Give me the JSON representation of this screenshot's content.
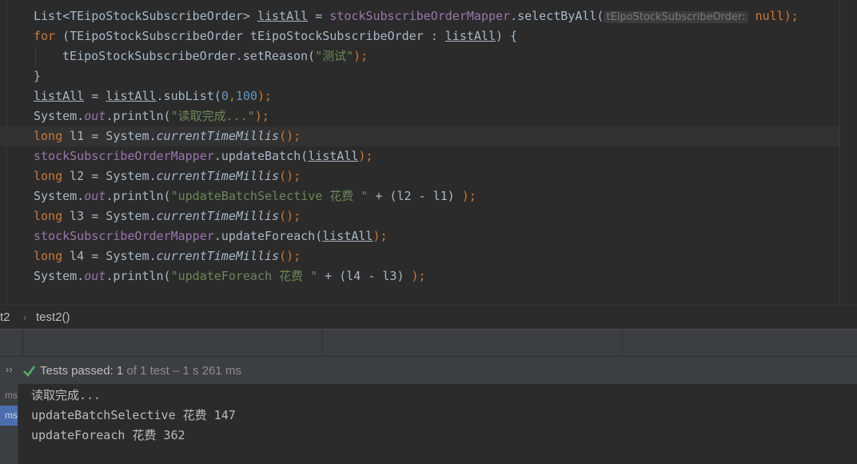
{
  "editor": {
    "lines": [
      {
        "seg": [
          {
            "t": "List<TEipoStockSubscribeOrder> "
          },
          {
            "t": "listAll",
            "c": "ul"
          },
          {
            "t": " = "
          },
          {
            "t": "stockSubscribeOrderMapper",
            "c": "fld"
          },
          {
            "t": ".selectByAll("
          },
          {
            "t": "tEipoStockSubscribeOrder:",
            "c": "hint"
          },
          {
            "t": " "
          },
          {
            "t": "null",
            "c": "kw"
          },
          {
            "t": ");",
            "c": "kw"
          }
        ]
      },
      {
        "seg": [
          {
            "t": "for",
            "c": "kw"
          },
          {
            "t": " (TEipoStockSubscribeOrder tEipoStockSubscribeOrder : "
          },
          {
            "t": "listAll",
            "c": "ul"
          },
          {
            "t": ") {"
          }
        ]
      },
      {
        "indent": true,
        "seg": [
          {
            "t": "tEipoStockSubscribeOrder.setReason("
          },
          {
            "t": "\"测试\"",
            "c": "str"
          },
          {
            "t": ");",
            "c": "kw"
          }
        ]
      },
      {
        "seg": [
          {
            "t": "}"
          }
        ]
      },
      {
        "seg": [
          {
            "t": "listAll",
            "c": "ul"
          },
          {
            "t": " = "
          },
          {
            "t": "listAll",
            "c": "ul"
          },
          {
            "t": ".subList("
          },
          {
            "t": "0",
            "c": "num"
          },
          {
            "t": ",",
            "c": "kw"
          },
          {
            "t": "100",
            "c": "num"
          },
          {
            "t": ");",
            "c": "kw"
          }
        ]
      },
      {
        "seg": [
          {
            "t": "System."
          },
          {
            "t": "out",
            "c": "fld it"
          },
          {
            "t": ".println("
          },
          {
            "t": "\"读取完成...\"",
            "c": "str"
          },
          {
            "t": ");",
            "c": "kw"
          }
        ]
      },
      {
        "current": true,
        "seg": [
          {
            "t": "long",
            "c": "kw"
          },
          {
            "t": " l1 = System."
          },
          {
            "t": "currentTimeMillis",
            "c": "it"
          },
          {
            "t": "();",
            "c": "kw"
          }
        ]
      },
      {
        "seg": [
          {
            "t": "stockSubscribeOrderMapper",
            "c": "fld"
          },
          {
            "t": ".updateBatch("
          },
          {
            "t": "listAll",
            "c": "ul"
          },
          {
            "t": ");",
            "c": "kw"
          }
        ]
      },
      {
        "seg": [
          {
            "t": "long",
            "c": "kw"
          },
          {
            "t": " l2 = System."
          },
          {
            "t": "currentTimeMillis",
            "c": "it"
          },
          {
            "t": "();",
            "c": "kw"
          }
        ]
      },
      {
        "seg": [
          {
            "t": "System."
          },
          {
            "t": "out",
            "c": "fld it"
          },
          {
            "t": ".println("
          },
          {
            "t": "\"updateBatchSelective 花费 \"",
            "c": "str"
          },
          {
            "t": " + (l2 - l1) "
          },
          {
            "t": ");",
            "c": "kw"
          }
        ]
      },
      {
        "seg": [
          {
            "t": "long",
            "c": "kw"
          },
          {
            "t": " l3 = System."
          },
          {
            "t": "currentTimeMillis",
            "c": "it"
          },
          {
            "t": "();",
            "c": "kw"
          }
        ]
      },
      {
        "seg": [
          {
            "t": "stockSubscribeOrderMapper",
            "c": "fld"
          },
          {
            "t": ".updateForeach("
          },
          {
            "t": "listAll",
            "c": "ul"
          },
          {
            "t": ");",
            "c": "kw"
          }
        ]
      },
      {
        "seg": [
          {
            "t": "long",
            "c": "kw"
          },
          {
            "t": " l4 = System."
          },
          {
            "t": "currentTimeMillis",
            "c": "it"
          },
          {
            "t": "();",
            "c": "kw"
          }
        ]
      },
      {
        "seg": [
          {
            "t": "System."
          },
          {
            "t": "out",
            "c": "fld it"
          },
          {
            "t": ".println("
          },
          {
            "t": "\"updateForeach 花费 \"",
            "c": "str"
          },
          {
            "t": " + (l4 - l3) "
          },
          {
            "t": ");",
            "c": "kw"
          }
        ]
      }
    ]
  },
  "breadcrumb": {
    "class_name": "t2",
    "separator": "›",
    "method_name": "test2()"
  },
  "status": {
    "chevron": "››",
    "passed_label": "Tests passed:",
    "passed_count": "1",
    "passed_detail": "of 1 test – 1 s 261 ms",
    "check_color": "#59a869"
  },
  "test_tree": {
    "rows": [
      "ms",
      "ms"
    ]
  },
  "console": {
    "lines": [
      "读取完成...",
      "updateBatchSelective 花费 147",
      "updateForeach 花费 362"
    ]
  }
}
